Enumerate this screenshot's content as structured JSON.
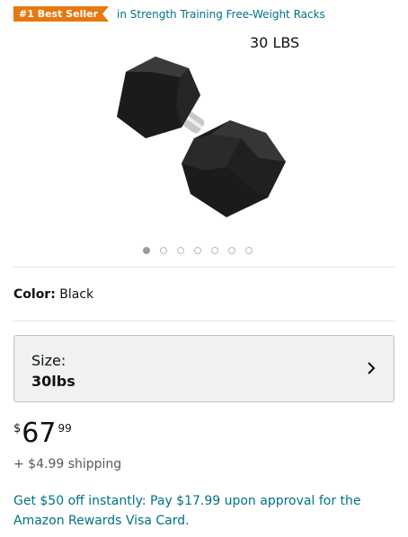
{
  "badge": {
    "label": "#1 Best Seller",
    "color": "#e47911"
  },
  "category": {
    "link_text": "in Strength Training Free-Weight Racks"
  },
  "image": {
    "caption": "30 LBS",
    "alt_icon": "hex-dumbbell-icon"
  },
  "carousel": {
    "count": 7,
    "active_index": 0
  },
  "color": {
    "label": "Color:",
    "value": "Black"
  },
  "size": {
    "label": "Size:",
    "value": "30lbs",
    "icon": "chevron-right-icon"
  },
  "price": {
    "symbol": "$",
    "whole": "67",
    "fraction": "99"
  },
  "shipping": {
    "text": "+ $4.99 shipping"
  },
  "promo": {
    "text": "Get $50 off instantly: Pay $17.99 upon approval for the Amazon Rewards Visa Card."
  },
  "colors": {
    "link": "#007185",
    "text": "#0f1111",
    "secondary": "#565959"
  }
}
